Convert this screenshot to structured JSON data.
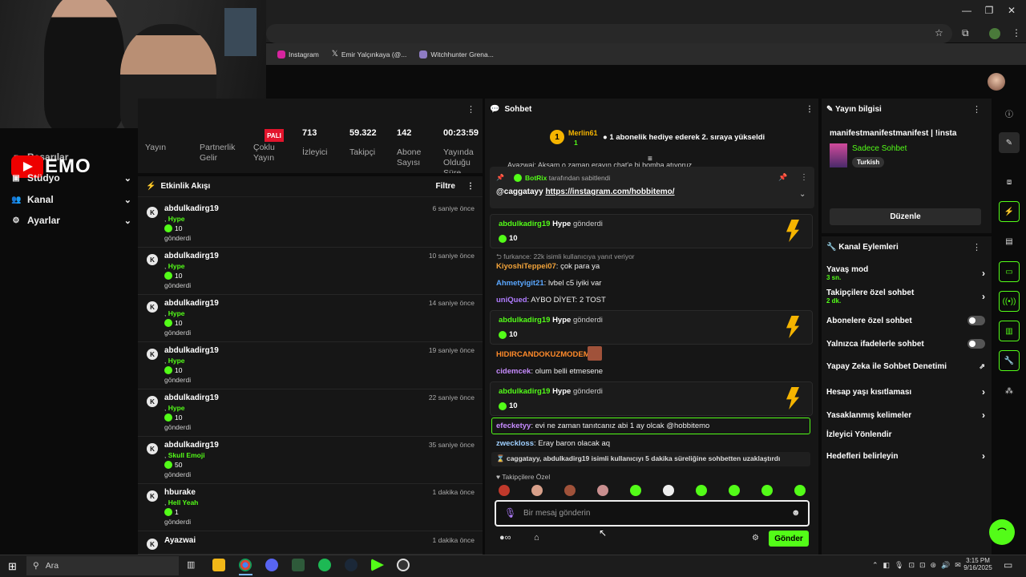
{
  "browser": {
    "bookmarks": [
      {
        "label": "Instagram",
        "color": "#d6249f"
      },
      {
        "label": "Emir Yalçınkaya (@...",
        "color": "#fff"
      },
      {
        "label": "Witchhunter Grena...",
        "color": "#8e7cc3"
      }
    ]
  },
  "sidebar": {
    "logo_text": "EMO",
    "items": [
      {
        "label": "Başarılar"
      },
      {
        "label": "Stüdyo"
      },
      {
        "label": "Kanal"
      },
      {
        "label": "Ayarlar"
      }
    ]
  },
  "stats": {
    "live": "PALI",
    "items": [
      {
        "label": "Yayın",
        "value": ""
      },
      {
        "label": "Partnerlik Gelir",
        "value": ""
      },
      {
        "label": "Çoklu Yayın",
        "value": ""
      },
      {
        "label": "İzleyici",
        "value": "713"
      },
      {
        "label": "Takipçi",
        "value": "59.322"
      },
      {
        "label": "Abone Sayısı",
        "value": "142"
      },
      {
        "label": "Yayında Olduğu Süre",
        "value": "00:23:59"
      }
    ]
  },
  "activity": {
    "title": "Etkinlik Akışı",
    "filter": "Filtre",
    "events": [
      {
        "user": "abdulkadirg19",
        "gift": "Hype",
        "amount": "10",
        "sent": "gönderdi",
        "time": "6 saniye önce"
      },
      {
        "user": "abdulkadirg19",
        "gift": "Hype",
        "amount": "10",
        "sent": "gönderdi",
        "time": "10 saniye önce"
      },
      {
        "user": "abdulkadirg19",
        "gift": "Hype",
        "amount": "10",
        "sent": "gönderdi",
        "time": "14 saniye önce"
      },
      {
        "user": "abdulkadirg19",
        "gift": "Hype",
        "amount": "10",
        "sent": "gönderdi",
        "time": "19 saniye önce"
      },
      {
        "user": "abdulkadirg19",
        "gift": "Hype",
        "amount": "10",
        "sent": "gönderdi",
        "time": "22 saniye önce"
      },
      {
        "user": "abdulkadirg19",
        "gift": "Skull Emoji",
        "amount": "50",
        "sent": "gönderdi",
        "time": "35 saniye önce"
      },
      {
        "user": "hburake",
        "gift": "Hell Yeah",
        "amount": "1",
        "sent": "gönderdi",
        "time": "1 dakika önce"
      },
      {
        "user": "Ayazwai",
        "gift": "",
        "amount": "",
        "sent": "",
        "time": "1 dakika önce"
      }
    ]
  },
  "chat": {
    "title": "Sohbet",
    "top_user": "Merlin61",
    "top_count": "1",
    "top_msg": "1 abonelik hediye ederek 2. sıraya yükseldi",
    "cut_msg": "Ayazwai: Akşam o zaman erayın chat'e bi bomba atıyoruz",
    "pinned_by": "BotRix",
    "pinned_label": "tarafından sabitlendi",
    "pinned_user": "@caggatayy",
    "pinned_link": "https://instagram.com/hobbitemo/",
    "hype_user": "abdulkadirg19",
    "hype_word": "Hype",
    "hype_sent": "gönderdi",
    "hype_amount": "10",
    "reply_note": "furkance: 22k isimli kullanıcıya yanıt veriyor",
    "messages": [
      {
        "user": "KiyoshiTeppei07",
        "text": "çok para ya",
        "color": "#f2a33a"
      },
      {
        "user": "Ahmetyigit21",
        "text": "lvbel c5 iyiki var",
        "color": "#5aa7ff"
      },
      {
        "user": "uniQued",
        "text": "AYBO DİYET: 2 TOST",
        "color": "#b07cff"
      },
      {
        "user": "HIDIRCANDOKUZMODEM",
        "text": "",
        "color": "#ff8a2a"
      },
      {
        "user": "cidemcek",
        "text": "olum belli etmesene",
        "color": "#c78cff"
      },
      {
        "user": "efecketyy",
        "text": "evi ne zaman tanıtcanız abi 1 ay olcak @hobbitemo",
        "color": "#c78cff"
      },
      {
        "user": "zweckloss",
        "text": "Eray baron olacak aq",
        "color": "#9fd0ff"
      }
    ],
    "timeout": "caggatayy, abdulkadirg19 isimli kullanıcıyı 5 dakika süreliğine sohbetten uzaklaştırdı",
    "emote_label": "Takipçilere Özel",
    "input_placeholder": "Bir mesaj gönderin",
    "send": "Gönder"
  },
  "info": {
    "title": "Yayın bilgisi",
    "stream_title": "manifestmanifestmanifest | !insta",
    "category": "Sadece Sohbet",
    "tag": "Turkish",
    "edit": "Düzenle"
  },
  "actions": {
    "title": "Kanal Eylemleri",
    "rows": [
      {
        "label": "Yavaş mod",
        "sub": "3 sn.",
        "kind": "chev"
      },
      {
        "label": "Takipçilere özel sohbet",
        "sub": "2 dk.",
        "kind": "chev"
      },
      {
        "label": "Abonelere özel sohbet",
        "sub": "",
        "kind": "toggle"
      },
      {
        "label": "Yalnızca ifadelerle sohbet",
        "sub": "",
        "kind": "toggle"
      },
      {
        "label": "Yapay Zeka ile Sohbet Denetimi",
        "sub": "",
        "kind": "ext"
      },
      {
        "label": "Hesap yaşı kısıtlaması",
        "sub": "",
        "kind": "chev"
      },
      {
        "label": "Yasaklanmış kelimeler",
        "sub": "",
        "kind": "chev"
      },
      {
        "label": "İzleyici Yönlendir",
        "sub": "",
        "kind": "none"
      },
      {
        "label": "Hedefleri belirleyin",
        "sub": "",
        "kind": "chev"
      }
    ]
  },
  "taskbar": {
    "search": "Ara",
    "time": "3:15 PM",
    "date": "9/16/2025"
  }
}
